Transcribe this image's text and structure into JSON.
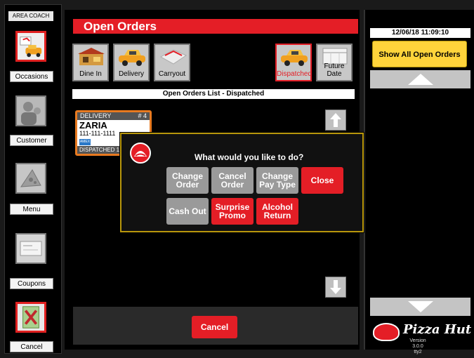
{
  "left_rail": {
    "role": "AREA COACH",
    "items": [
      {
        "label": "Occasions",
        "icon": "occasions-icon",
        "active": true
      },
      {
        "label": "Customer",
        "icon": "customer-icon",
        "active": false
      },
      {
        "label": "Menu",
        "icon": "menu-icon",
        "active": false
      },
      {
        "label": "Coupons",
        "icon": "coupons-icon",
        "active": false
      },
      {
        "label": "Cancel",
        "icon": "cancel-icon",
        "active": false
      }
    ]
  },
  "header": {
    "title": "Open Orders"
  },
  "filters": {
    "dine_in": "Dine In",
    "delivery": "Delivery",
    "carryout": "Carryout",
    "dispatched": "Dispatched",
    "future_date": "Future Date"
  },
  "list": {
    "caption": "Open Orders List - Dispatched",
    "orders": [
      {
        "type": "DELIVERY",
        "number": "# 4",
        "name": "ZARIA",
        "phone": "111-111-1111",
        "payment": "AMEX",
        "status": "DISPATCHED 10"
      }
    ]
  },
  "dialog": {
    "prompt": "What would you like to do?",
    "buttons": {
      "change_order": "Change Order",
      "cancel_order": "Cancel Order",
      "change_pay_type": "Change Pay Type",
      "close": "Close",
      "cash_out": "Cash Out",
      "surprise_promo": "Surprise Promo",
      "alcohol_return": "Alcohol Return"
    }
  },
  "bottom": {
    "cancel": "Cancel"
  },
  "right_rail": {
    "datetime": "12/06/18 11:09:10",
    "show_all": "Show All Open Orders",
    "brand": "Pizza Hut",
    "version": "Version 3.0.0",
    "terminal": "tty2"
  },
  "colors": {
    "brand_red": "#e41e26",
    "accent_yellow": "#ffd43b",
    "dialog_border": "#b8960b"
  }
}
